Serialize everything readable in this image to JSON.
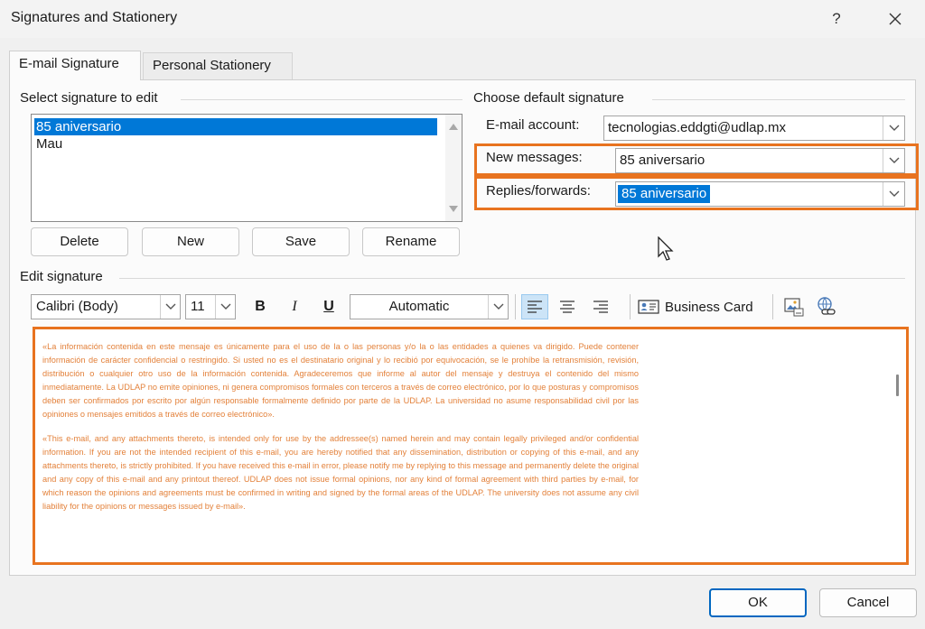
{
  "window": {
    "title": "Signatures and Stationery",
    "help_label": "?"
  },
  "tabs": [
    {
      "label": "E-mail Signature",
      "active": true
    },
    {
      "label": "Personal Stationery",
      "active": false
    }
  ],
  "select_signature": {
    "label": "Select signature to edit",
    "items": [
      {
        "label": "85 aniversario",
        "selected": true
      },
      {
        "label": "Mau",
        "selected": false
      }
    ]
  },
  "signature_buttons": {
    "delete": "Delete",
    "new": "New",
    "save": "Save",
    "rename": "Rename"
  },
  "default_signature": {
    "label": "Choose default signature",
    "email_account_label": "E-mail account:",
    "email_account_value": "tecnologias.eddgti@udlap.mx",
    "new_messages_label": "New messages:",
    "new_messages_value": "85 aniversario",
    "replies_label": "Replies/forwards:",
    "replies_value": "85 aniversario"
  },
  "edit_signature": {
    "label": "Edit signature",
    "toolbar": {
      "font": "Calibri (Body)",
      "size": "11",
      "bold": "B",
      "italic": "I",
      "underline": "U",
      "color": "Automatic",
      "business_card": "Business Card"
    },
    "body_color": "#e3813a",
    "paragraphs": [
      "«La información contenida en este mensaje es únicamente para el uso de la o las personas y/o la o las entidades a quienes va dirigido. Puede contener información de carácter confidencial o restringido. Si usted no es el destinatario original y lo recibió por equivocación, se le prohíbe la retransmisión, revisión, distribución o cualquier otro uso de la información contenida. Agradeceremos que informe al autor del mensaje y destruya el contenido del mismo inmediatamente. La UDLAP no emite opiniones, ni genera compromisos formales con terceros a través de correo electrónico, por lo que posturas y compromisos deben ser confirmados por escrito por algún responsable formalmente definido por parte de la UDLAP. La universidad no asume responsabilidad civil por las opiniones o mensajes emitidos a través de correo electrónico».",
      "«This e-mail, and any attachments thereto, is intended only for use by the addressee(s) named herein and may contain legally privileged and/or confidential information. If you are not the intended recipient of this e-mail, you are hereby notified that any dissemination, distribution or copying of this e-mail, and any attachments thereto, is strictly prohibited. If you have received this e-mail in error, please notify me by replying to this message and permanently delete the original and any copy of this e-mail and any printout thereof. UDLAP does not issue formal opinions, nor any kind of formal agreement with third parties by e-mail, for which reason the opinions and agreements must be confirmed in writing and signed by the formal areas of the UDLAP. The university does not assume any civil liability for the opinions or messages issued by e-mail»."
    ]
  },
  "dialog_buttons": {
    "ok": "OK",
    "cancel": "Cancel"
  },
  "colors": {
    "highlight": "#e8731f",
    "selection": "#0078d7",
    "accent": "#0067c0"
  }
}
